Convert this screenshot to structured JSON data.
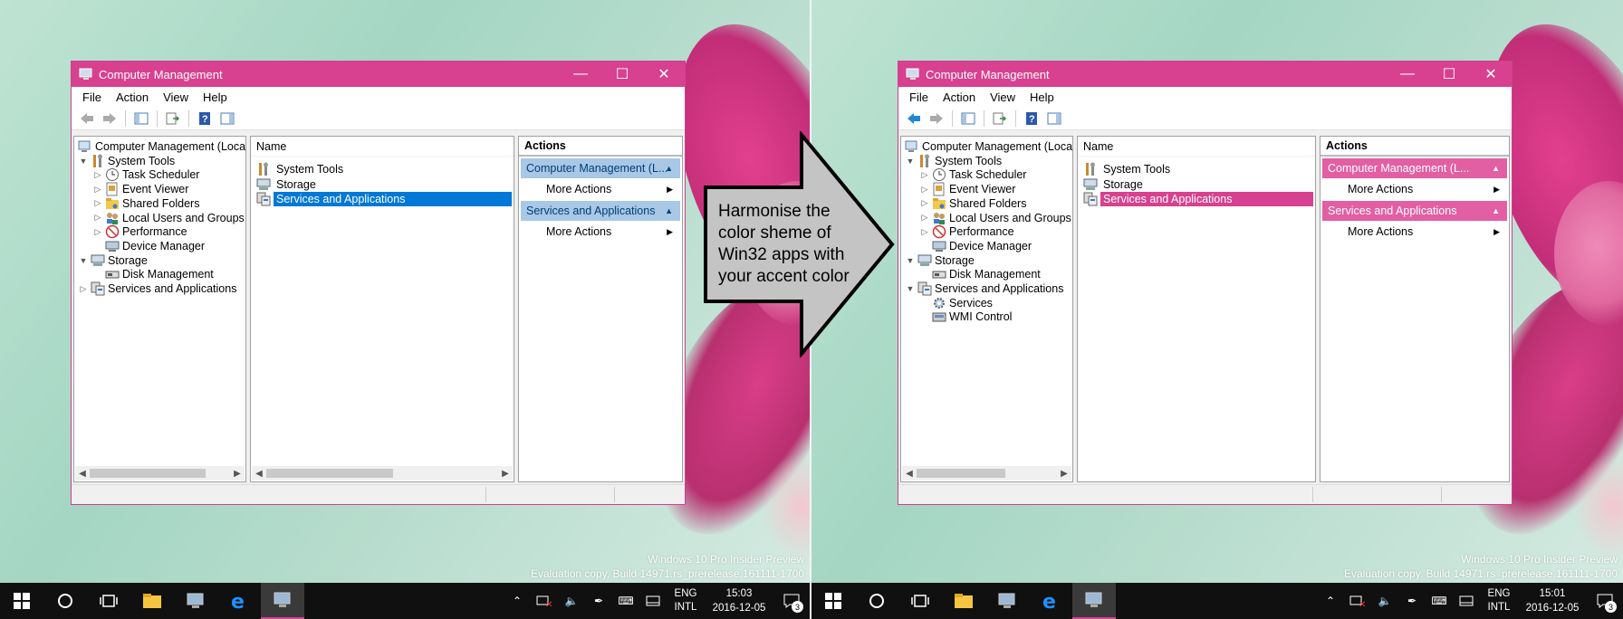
{
  "screens": [
    {
      "theme": "default",
      "window": {
        "title": "Computer Management",
        "controls": {
          "minimize": "minimize-icon",
          "maximize": "maximize-icon",
          "close": "close-icon"
        },
        "menu": [
          "File",
          "Action",
          "View",
          "Help"
        ],
        "tree": [
          {
            "label": "Computer Management (Local",
            "level": 0,
            "expander": "",
            "icon": "computer-management-icon"
          },
          {
            "label": "System Tools",
            "level": 1,
            "expander": "expanded",
            "icon": "system-tools-icon"
          },
          {
            "label": "Task Scheduler",
            "level": 2,
            "expander": "collapsed",
            "icon": "clock-icon"
          },
          {
            "label": "Event Viewer",
            "level": 2,
            "expander": "collapsed",
            "icon": "event-viewer-icon"
          },
          {
            "label": "Shared Folders",
            "level": 2,
            "expander": "collapsed",
            "icon": "shared-folders-icon"
          },
          {
            "label": "Local Users and Groups",
            "level": 2,
            "expander": "collapsed",
            "icon": "users-icon"
          },
          {
            "label": "Performance",
            "level": 2,
            "expander": "collapsed",
            "icon": "performance-icon"
          },
          {
            "label": "Device Manager",
            "level": 2,
            "expander": "",
            "icon": "device-manager-icon"
          },
          {
            "label": "Storage",
            "level": 1,
            "expander": "expanded",
            "icon": "storage-icon"
          },
          {
            "label": "Disk Management",
            "level": 2,
            "expander": "",
            "icon": "disk-icon"
          },
          {
            "label": "Services and Applications",
            "level": 1,
            "expander": "collapsed",
            "icon": "services-apps-icon"
          }
        ],
        "list": {
          "column": "Name",
          "items": [
            {
              "label": "System Tools",
              "icon": "system-tools-icon",
              "selected": false
            },
            {
              "label": "Storage",
              "icon": "storage-icon",
              "selected": false
            },
            {
              "label": "Services and Applications",
              "icon": "services-apps-icon",
              "selected": true
            }
          ]
        },
        "actions": {
          "header": "Actions",
          "sections": [
            {
              "title": "Computer Management (L...",
              "item": "More Actions"
            },
            {
              "title": "Services and Applications",
              "item": "More Actions"
            }
          ]
        }
      },
      "watermark": [
        "Windows 10 Pro Insider Preview",
        "Evaluation copy. Build 14971.rs_prerelease.161111-1700"
      ],
      "taskbar": {
        "lang1": "ENG",
        "lang2": "INTL",
        "time": "15:03",
        "date": "2016-12-05",
        "notifications": "3"
      }
    },
    {
      "theme": "accent",
      "window": {
        "title": "Computer Management",
        "controls": {
          "minimize": "minimize-icon",
          "maximize": "maximize-icon",
          "close": "close-icon"
        },
        "menu": [
          "File",
          "Action",
          "View",
          "Help"
        ],
        "tree": [
          {
            "label": "Computer Management (Local",
            "level": 0,
            "expander": "",
            "icon": "computer-management-icon"
          },
          {
            "label": "System Tools",
            "level": 1,
            "expander": "expanded",
            "icon": "system-tools-icon"
          },
          {
            "label": "Task Scheduler",
            "level": 2,
            "expander": "collapsed",
            "icon": "clock-icon"
          },
          {
            "label": "Event Viewer",
            "level": 2,
            "expander": "collapsed",
            "icon": "event-viewer-icon"
          },
          {
            "label": "Shared Folders",
            "level": 2,
            "expander": "collapsed",
            "icon": "shared-folders-icon"
          },
          {
            "label": "Local Users and Groups",
            "level": 2,
            "expander": "collapsed",
            "icon": "users-icon"
          },
          {
            "label": "Performance",
            "level": 2,
            "expander": "collapsed",
            "icon": "performance-icon"
          },
          {
            "label": "Device Manager",
            "level": 2,
            "expander": "",
            "icon": "device-manager-icon"
          },
          {
            "label": "Storage",
            "level": 1,
            "expander": "expanded",
            "icon": "storage-icon"
          },
          {
            "label": "Disk Management",
            "level": 2,
            "expander": "",
            "icon": "disk-icon"
          },
          {
            "label": "Services and Applications",
            "level": 1,
            "expander": "expanded",
            "icon": "services-apps-icon"
          },
          {
            "label": "Services",
            "level": 2,
            "expander": "",
            "icon": "services-gear-icon"
          },
          {
            "label": "WMI Control",
            "level": 2,
            "expander": "",
            "icon": "wmi-control-icon"
          }
        ],
        "list": {
          "column": "Name",
          "items": [
            {
              "label": "System Tools",
              "icon": "system-tools-icon",
              "selected": false
            },
            {
              "label": "Storage",
              "icon": "storage-icon",
              "selected": false
            },
            {
              "label": "Services and Applications",
              "icon": "services-apps-icon",
              "selected": true
            }
          ]
        },
        "actions": {
          "header": "Actions",
          "sections": [
            {
              "title": "Computer Management (L...",
              "item": "More Actions"
            },
            {
              "title": "Services and Applications",
              "item": "More Actions"
            }
          ]
        }
      },
      "watermark": [
        "Windows 10 Pro Insider Preview",
        "Evaluation copy. Build 14971.rs_prerelease.161111-1700"
      ],
      "taskbar": {
        "lang1": "ENG",
        "lang2": "INTL",
        "time": "15:01",
        "date": "2016-12-05",
        "notifications": "3"
      }
    }
  ],
  "callout": {
    "text": "Harmonise the color sheme of Win32 apps with your accent color"
  },
  "colors": {
    "accent": "#d7418f",
    "selection_default": "#0078d7",
    "action_section_default": "#a8c8e6",
    "action_section_accent": "#e25fa4",
    "taskbar": "#101010"
  }
}
